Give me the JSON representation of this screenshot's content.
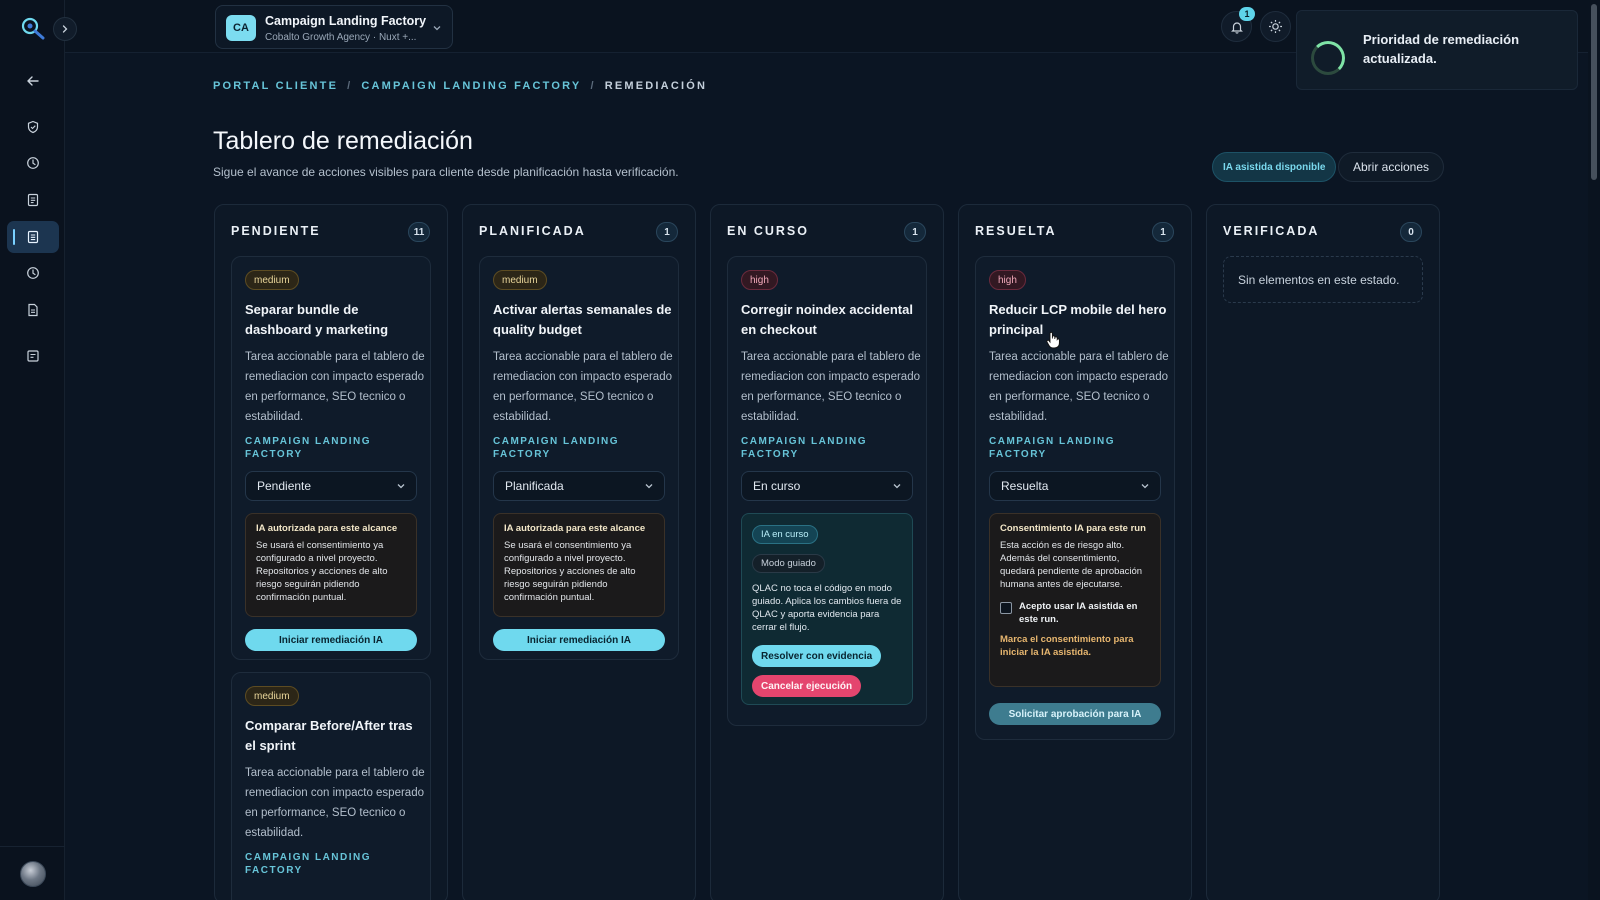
{
  "colors": {
    "background": "#0b1523",
    "accent": "#6fd9ee",
    "breadcrumb": "#67c4d8",
    "danger": "#e4456e",
    "warning_text": "#e7b66f"
  },
  "sidebar": {
    "icons": [
      "back-arrow-icon",
      "shield-icon",
      "clock-icon",
      "document-icon",
      "board-icon",
      "history-icon",
      "report-icon",
      "list-icon"
    ]
  },
  "topbar": {
    "project_initials": "CA",
    "project_name": "Campaign Landing Factory",
    "project_subtitle": "Cobalto Growth Agency · Nuxt +...",
    "notification_count": "1"
  },
  "toast": {
    "message": "Prioridad de remediación actualizada."
  },
  "breadcrumb": {
    "items": [
      "PORTAL CLIENTE",
      "CAMPAIGN LANDING FACTORY",
      "REMEDIACIÓN"
    ],
    "separator": "/"
  },
  "header": {
    "title": "Tablero de remediación",
    "subtitle": "Sigue el avance de acciones visibles para cliente desde planificación hasta verificación.",
    "ai_chip": "IA asistida disponible",
    "actions_button": "Abrir acciones"
  },
  "columns": [
    {
      "title": "PENDIENTE",
      "count": "11",
      "cards": [
        {
          "priority": "medium",
          "title": "Separar bundle de dashboard y marketing",
          "description": "Tarea accionable para el tablero de remediacion con impacto esperado en performance, SEO tecnico o estabilidad.",
          "project": "CAMPAIGN LANDING FACTORY",
          "status": "Pendiente",
          "ai_title": "IA autorizada para este alcance",
          "ai_text": "Se usará el consentimiento ya configurado a nivel proyecto. Repositorios y acciones de alto riesgo seguirán pidiendo confirmación puntual.",
          "button": "Iniciar remediación IA"
        },
        {
          "priority": "medium",
          "title": "Comparar Before/After tras el sprint",
          "description": "Tarea accionable para el tablero de remediacion con impacto esperado en performance, SEO tecnico o estabilidad.",
          "project": "CAMPAIGN LANDING FACTORY"
        }
      ]
    },
    {
      "title": "PLANIFICADA",
      "count": "1",
      "cards": [
        {
          "priority": "medium",
          "title": "Activar alertas semanales de quality budget",
          "description": "Tarea accionable para el tablero de remediacion con impacto esperado en performance, SEO tecnico o estabilidad.",
          "project": "CAMPAIGN LANDING FACTORY",
          "status": "Planificada",
          "ai_title": "IA autorizada para este alcance",
          "ai_text": "Se usará el consentimiento ya configurado a nivel proyecto. Repositorios y acciones de alto riesgo seguirán pidiendo confirmación puntual.",
          "button": "Iniciar remediación IA"
        }
      ]
    },
    {
      "title": "EN CURSO",
      "count": "1",
      "cards": [
        {
          "priority": "high",
          "title": "Corregir noindex accidental en checkout",
          "description": "Tarea accionable para el tablero de remediacion con impacto esperado en performance, SEO tecnico o estabilidad.",
          "project": "CAMPAIGN LANDING FACTORY",
          "status": "En curso",
          "run_badge": "IA en curso",
          "mode_badge": "Modo guiado",
          "run_text": "QLAC no toca el código en modo guiado. Aplica los cambios fuera de QLAC y aporta evidencia para cerrar el flujo.",
          "resolve_button": "Resolver con evidencia",
          "cancel_button": "Cancelar ejecución"
        }
      ]
    },
    {
      "title": "RESUELTA",
      "count": "1",
      "cards": [
        {
          "priority": "high",
          "title": "Reducir LCP mobile del hero principal",
          "description": "Tarea accionable para el tablero de remediacion con impacto esperado en performance, SEO tecnico o estabilidad.",
          "project": "CAMPAIGN LANDING FACTORY",
          "status": "Resuelta",
          "consent_title": "Consentimiento IA para este run",
          "consent_text": "Esta acción es de riesgo alto. Además del consentimiento, quedará pendiente de aprobación humana antes de ejecutarse.",
          "consent_label": "Acepto usar IA asistida en este run.",
          "consent_warning": "Marca el consentimiento para iniciar la IA asistida.",
          "approval_button": "Solicitar aprobación para IA"
        }
      ]
    },
    {
      "title": "VERIFICADA",
      "count": "0",
      "empty_text": "Sin elementos en este estado."
    }
  ]
}
